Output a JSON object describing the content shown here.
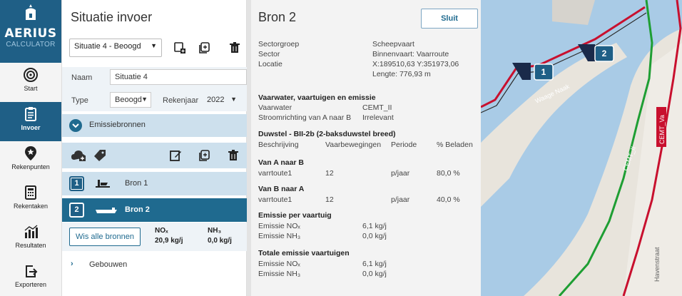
{
  "app": {
    "logo_name": "AERIUS",
    "logo_sub": "CALCULATOR"
  },
  "nav": {
    "items": [
      {
        "label": "Start",
        "icon": "target-icon"
      },
      {
        "label": "Invoer",
        "icon": "clipboard-icon",
        "active": true
      },
      {
        "label": "Rekenpunten",
        "icon": "map-pin-star-icon"
      },
      {
        "label": "Rekentaken",
        "icon": "calculator-icon"
      },
      {
        "label": "Resultaten",
        "icon": "chart-icon"
      },
      {
        "label": "Exporteren",
        "icon": "export-icon"
      }
    ]
  },
  "situatie": {
    "title": "Situatie invoer",
    "selected": "Situatie 4 - Beoogd",
    "naam_label": "Naam",
    "naam_value": "Situatie 4",
    "type_label": "Type",
    "type_value": "Beoogd",
    "rekenjaar_label": "Rekenjaar",
    "rekenjaar_value": "2022",
    "emissiebronnen_label": "Emissiebronnen",
    "sources": [
      {
        "badge": "1",
        "label": "Bron 1"
      },
      {
        "badge": "2",
        "label": "Bron 2"
      }
    ],
    "wis_label": "Wis alle bronnen",
    "nox_label": "NOₓ",
    "nox_value": "20,9 kg/j",
    "nh3_label": "NH₃",
    "nh3_value": "0,0 kg/j",
    "gebouwen_label": "Gebouwen"
  },
  "detail": {
    "title": "Bron 2",
    "close_label": "Sluit",
    "sectorgroep_label": "Sectorgroep",
    "sectorgroep_value": "Scheepvaart",
    "sector_label": "Sector",
    "sector_value": "Binnenvaart: Vaarroute",
    "locatie_label": "Locatie",
    "locatie_value": "X:189510,63 Y:351973,06",
    "lengte_value": "Lengte: 776,93 m",
    "section1_title": "Vaarwater, vaartuigen en emissie",
    "vaarwater_label": "Vaarwater",
    "vaarwater_value": "CEMT_II",
    "stroom_label": "Stroomrichting van A naar B",
    "stroom_value": "Irrelevant",
    "duwstel_title": "Duwstel - BII-2b (2-baksduwstel breed)",
    "col_beschrijving": "Beschrijving",
    "col_vaarbewegingen": "Vaarbewegingen",
    "col_periode": "Periode",
    "col_beladen": "% Beladen",
    "ab_title": "Van A naar B",
    "ab_row": {
      "desc": "varrtoute1",
      "count": "12",
      "periode": "p/jaar",
      "beladen": "80,0 %"
    },
    "ba_title": "Van B naar A",
    "ba_row": {
      "desc": "varrtoute1",
      "count": "12",
      "periode": "p/jaar",
      "beladen": "40,0 %"
    },
    "per_title": "Emissie per vaartuig",
    "per_nox_label": "Emissie NOₓ",
    "per_nox_value": "6,1 kg/j",
    "per_nh3_label": "Emissie NH₃",
    "per_nh3_value": "0,0 kg/j",
    "tot_title": "Totale emissie vaartuigen",
    "tot_nox_label": "Emissie NOₓ",
    "tot_nox_value": "6,1 kg/j",
    "tot_nh3_label": "Emissie NH₃",
    "tot_nh3_value": "0,0 kg/j"
  },
  "map": {
    "labels": {
      "waage": "Waage Naak",
      "cemt_ii": "CEMT_II",
      "cemt_va": "CEMT_Va",
      "havenstraat": "Havenstraat"
    },
    "markers": [
      "1",
      "2"
    ]
  },
  "colors": {
    "brand": "#1f5f86",
    "row_selected": "#1f6a8f",
    "row_hover": "#cde0ed",
    "water": "#a9cbe6",
    "route_red": "#c8102e",
    "route_green": "#1e9e33"
  }
}
